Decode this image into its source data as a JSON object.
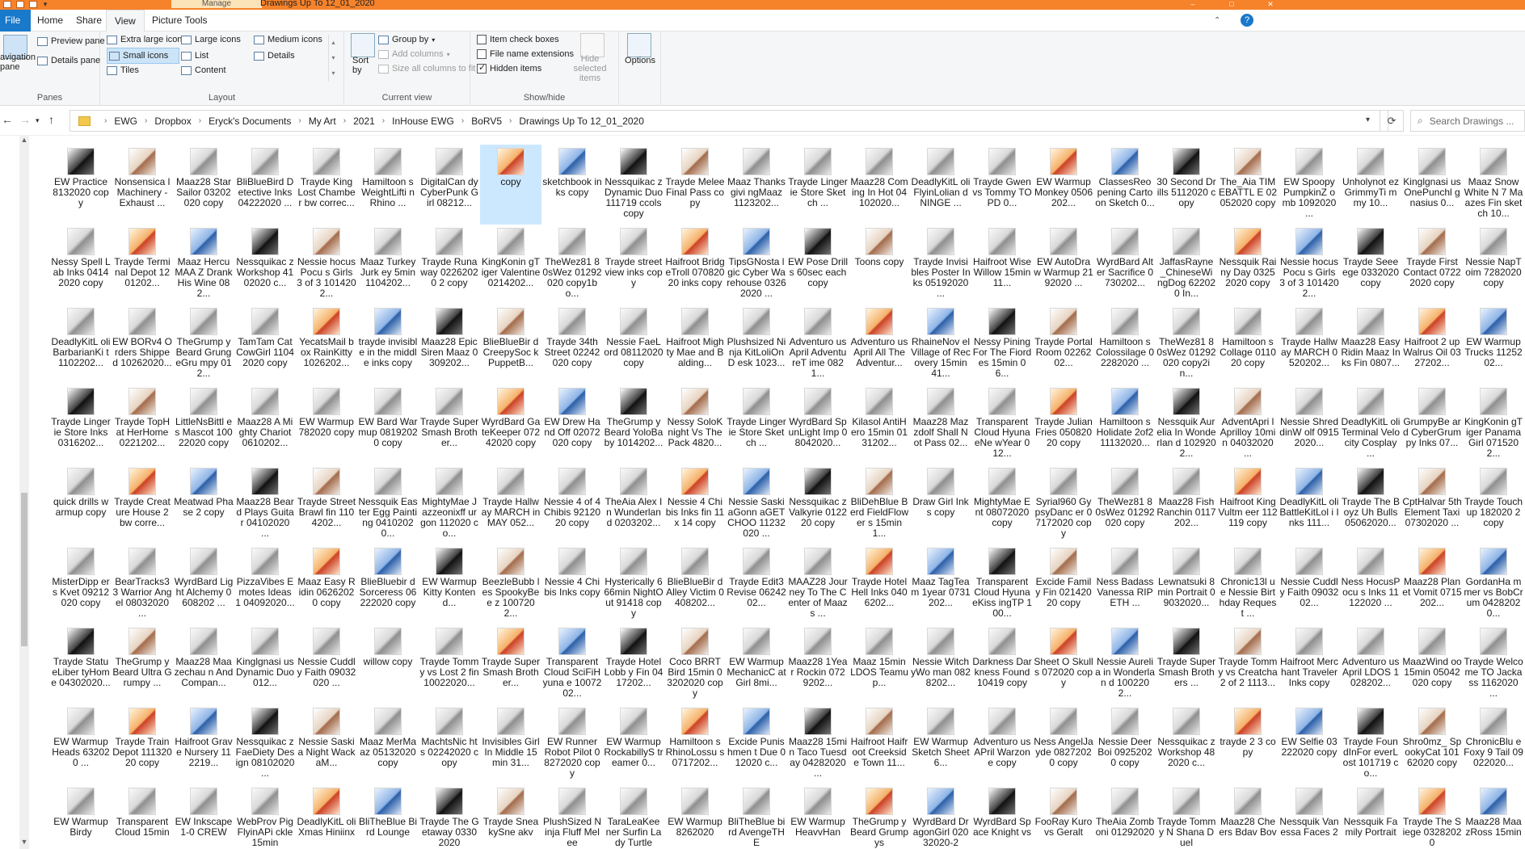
{
  "window": {
    "manage_tab": "Manage",
    "title": "Drawings Up To 12_01_2020"
  },
  "tabs": [
    {
      "label": "File"
    },
    {
      "label": "Home"
    },
    {
      "label": "Share"
    },
    {
      "label": "View"
    },
    {
      "label": "Picture Tools"
    }
  ],
  "ribbon": {
    "panes": {
      "nav_label": "avigation pane",
      "preview": "Preview pane",
      "details": "Details pane",
      "group": "Panes"
    },
    "layout": {
      "extra_large": "Extra large icons",
      "large": "Large icons",
      "medium": "Medium icons",
      "small": "Small icons",
      "list": "List",
      "details": "Details",
      "tiles": "Tiles",
      "content": "Content",
      "group": "Layout"
    },
    "current_view": {
      "sort": "Sort by",
      "group_by": "Group by",
      "add_columns": "Add columns",
      "size_all": "Size all columns to fit",
      "group": "Current view"
    },
    "show_hide": {
      "item_checkboxes": "Item check boxes",
      "file_name_ext": "File name extensions",
      "hidden_items": "Hidden items",
      "hide_selected": "Hide selected items",
      "group": "Show/hide"
    },
    "options": {
      "label": "Options"
    }
  },
  "address": {
    "crumbs": [
      "EWG",
      "Dropbox",
      "Eryck's Documents",
      "My Art",
      "2021",
      "InHouse EWG",
      "BoRV5",
      "Drawings Up To 12_01_2020"
    ],
    "search_placeholder": "Search Drawings ..."
  },
  "files": [
    "EW Practice 8132020 copy",
    "Nonsensica l Machinery - Exhaust ...",
    "Maaz28 StarSailor 03202020 copy",
    "BliBlueBird Detective Inks 04222020 ...",
    "Trayde King Lost Chamber bw correc...",
    "Hamiltoon s WeightLifti n Rhino ...",
    "DigitalCan dy CyberPunk Girl 08212...",
    "copy",
    "sketchbook inks copy",
    "Nessquikac z Dynamic Duo 111719 ccols copy",
    "Trayde Melee Final Pass copy",
    "Maaz Thanksgivi ngMaaz 1123202...",
    "Trayde Lingerie Store Sketch ...",
    "Maaz28 Coming In Hot 04102020...",
    "DeadlyKitL oli FlyinLolian dNINGE ...",
    "Trayde Gwen vs Tommy TOPD 0...",
    "EW Warmup Monkey 0506202...",
    "ClassesReo pening Cartoon Sketch 0...",
    "30 Second Drills 5112020 copy",
    "The_Aia TIMEBATTL E 02052020 copy",
    "EW Spoopy PumpkinZ omb 1092020 ...",
    "Unholynot ez GrimmyTi mmy 10...",
    "Kinglgnasi us OnePunchl gnasius 0...",
    "Maaz Snow White N 7 Maazes Fin sketch 10...",
    "Nessy Spell Lab Inks 04142020 copy",
    "Trayde Terminal Depot 1201202...",
    "Maaz HercuMAA Z Drank His Wine 082...",
    "Nessquikac z Workshop 4102020 c...",
    "Nessie hocusPocu s Girls 3 of 3 1014202...",
    "Maaz TurkeyJurk ey 5min 1104202...",
    "Trayde Runaway 02262020 2 copy",
    "KingKonin gTiger Valentine 0214202...",
    "TheWez81 80sWez 01292020 copy1bo...",
    "Trayde streetview inks copy",
    "Haifroot BridgeTroll 07082020 inks copy",
    "TipsGNosta lgic Cyber Warehouse 03262020 ...",
    "EW Pose Drills 60sec each copy",
    "Toons copy",
    "Trayde Invisibles Poster Inks 05192020 ...",
    "Haifroot Wise Willow 15min 11...",
    "EW AutoDraw Warmup 2192020 ...",
    "WyrdBard Alter Sacrifice 0730202...",
    "JaffasRayne _ChineseWi ngDog 622020 In...",
    "Nessquik Rainy Day 03252020 copy",
    "Nessie hocusPocu s Girls 3 of 3 1014202...",
    "Trayde Seeeege 0332020 copy",
    "Trayde First Contact 07222020 copy",
    "Nessie NapToim 7282020 copy",
    "DeadlyKitL oli BarbarianKi t 1102202...",
    "EW BORv4 Orders Shipped 10262020...",
    "TheGrump yBeard GrungeGru mpy 012...",
    "TamTam CatCowGirl 11042020 copy",
    "YecatsMail box RainKitty 1026202...",
    "trayde invisible in the middle inks copy",
    "Maaz28 Epic Siren Maaz 0309202...",
    "BlieBlueBir d CreepySoc kPuppetB...",
    "Trayde 34th Street 02242020 copy",
    "Nessie FaeLord 08112020 copy",
    "Haifroot Mighty Mae and Balding...",
    "Plushsized Ninja KitLoliOnD esk 1023...",
    "Adventuro usApril AdventureT ime 0821...",
    "Adventuro usApril All The Adventur...",
    "RhaineNov el Village of Recovery 15min 41...",
    "Nessy Pining For The Fiordes 15min 06...",
    "Trayde Portal Room 0226202...",
    "Hamiltoon s Colossilage 02282020 ...",
    "TheWez81 80sWez 01292020 copy2in...",
    "Hamiltoon s Collage 011020 copy",
    "Trayde Hallway MARCH 0520202...",
    "Maaz28 Easy Ridin Maaz Inks Fin 0807...",
    "Haifroot 2 up Walrus Oil 0327202...",
    "EW Warmup Trucks 1125202...",
    "Trayde Lingerie Store Inks 0316202...",
    "Trayde TopHat HerHome 0221202...",
    "LittleNsBittl es Mascot 10022020 copy",
    "Maaz28 A Mighty Chariot 0610202...",
    "EW Warmup 782020 copy",
    "EW Bard Warmup 08192020 copy",
    "Trayde Super Smash Brother...",
    "WyrdBard GateKeeper 07242020 copy",
    "EW Drew Hand Off 02072020 copy",
    "TheGrump yBeard YoloBaby 1014202...",
    "Nessy SoloKnight Vs The Pack 4820...",
    "Trayde Lingerie Store Sketch ...",
    "WyrdBard SpunLight Imp 08042020...",
    "Kilasol AntiHero 15min 0131202...",
    "Maaz28 Mazzdolf Shall Not Pass 02...",
    "Transparent Cloud HyunaeNe wYear 012...",
    "Trayde Julian Fries 05082020 copy",
    "Hamiltoon s Holidate 2of2 11132020...",
    "Nessquik Aurelia In Wonderlan d 1029202...",
    "AdventApri l Aprilloy 10min 04032020 ...",
    "Nessie ShreddinW olf 09152020...",
    "DeadlyKitL oli Terminal Velocity Cosplay ...",
    "GrumpyBe ard CyberGrum py Inks 07...",
    "KingKonin gTiger Panama Girl 0715202...",
    "quick drills warmup copy",
    "Trayde Creature House 2 bw corre...",
    "Meatwad Phase 2 copy",
    "Maaz28 Beard Plays Guitar 04102020 ...",
    "Trayde Street Brawl fin 1104202...",
    "Nessquik Easter Egg Painting 04102020...",
    "MightyMae Jazzeonixff urgon 112020 co...",
    "Trayde Hallway MARCH in MAY 052...",
    "Nessie 4 of 4 Chibis 9212020 copy",
    "TheAia Alex In Wunderlan d 0203202...",
    "Nessie 4 Chibis Inks fin 11 x 14 copy",
    "Nessie SaskiaGonn aGETCHOO 11232020 ...",
    "Nessquikac z Valkyrie 012220 copy",
    "BliDehBlue Berd FieldFlower s 15min 1...",
    "Draw Girl Inks copy",
    "MightyMae Ent 08072020 copy",
    "Syrial960 GypsyDanc er 07172020 copy",
    "TheWez81 80sWez 01292020 copy",
    "Maaz28 Fish Ranchin 0117202...",
    "Haifroot KingVultm eer 112119 copy",
    "DeadlyKitL oli BattleKitLol i Inks 111...",
    "Trayde The Boyz Uh Bulls 05062020...",
    "CptHalvar 5thElement Taxi 07302020 ...",
    "Trayde Touchup 182020 2 copy",
    "MisterDipp ers Kvet 09212020 copy",
    "BearTracks3 3 Warrior Angel 08032020 ...",
    "WyrdBard Light Alchemy 0608202 ...",
    "PizzaVibes Emotes Ideas 1 04092020...",
    "Maaz Easy Ridin 06262020 copy",
    "BlieBluebir d Sorceress 06222020 copy",
    "EW Warmup Kitty Kontend...",
    "BeezleBubb les SpookyBee z 1007202...",
    "Nessie 4 Chibis Inks copy",
    "Hysterically 666min NightOut 91418 copy",
    "BlieBlueBir d Alley Victim 0408202...",
    "Trayde Edit3 Revise 0624202...",
    "MAAZ28 Journey To The Center of Maazs ...",
    "Trayde Hotel Hell Inks 0406202...",
    "Maaz TagTeam 1year 0731202...",
    "Transparent Cloud HyunaeKiss ingTP 100...",
    "Excide Family Fin 02142020 copy",
    "Ness Badass Vanessa RIPETH ...",
    "Lewnatsuki 8min Portrait 09032020...",
    "Chronic13l ue Nessie Birthday Request ...",
    "Nessie Cuddly Faith 0903202...",
    "Ness HocusPocu s Inks 11122020 ...",
    "Maaz28 Planet Vomit 0715202...",
    "GordanHa mmer vs BobCrum 04282020...",
    "Trayde StatueLiber tyHome 04302020...",
    "TheGrump yBeard Ultra Grumpy ...",
    "Maaz28 Maazechau n And Compan...",
    "Kinglgnasi us Dynamic Duo 012...",
    "Nessie Cuddly Faith 09032020 ...",
    "willow copy",
    "Trayde Tommy vs Lost 2 fin 10022020...",
    "Trayde Super Smash Brother...",
    "Transparent Cloud SciFiHyuna e 1007202...",
    "Trayde HotelLobb y Fin 0417202...",
    "Coco BRRT Bird 15min 03202020 copy",
    "EW Warmup MechanicC atGirl 8mi...",
    "Maaz28 1Year Rockin 0729202...",
    "Maaz 15min LDOS Teamup...",
    "Nessie WitchyWo man 0828202...",
    "Darkness Darkness Found 10419 copy",
    "Sheet O Skulls 072020 copy",
    "Nessie Aurelia in Wonderlan d 1002202...",
    "Trayde Super Smash Brothers ...",
    "Trayde Tommy vs Creatcha 2 of 2 1113...",
    "Haifroot Merchant Traveler Inks copy",
    "Adventuro usApril LDOS 1028202...",
    "MaazWind oo 15min 05042020 copy",
    "Trayde Welcome TO Jackass 1162020 ...",
    "EW Warmup Heads 632020 ...",
    "Trayde Train Depot 11132020 copy",
    "Haifroot Grave Nursery 112219...",
    "Nessquikac z FaeDiety Design 08102020 ...",
    "Nessie Saskia Night WackaM...",
    "Maaz MerMaaz 05132020 copy",
    "MachtsNic hts 02242020 copy",
    "Invisibles Girl In Middle 15min 31...",
    "EW Runner Robot Pilot 08272020 copy",
    "EW Warmup RockabillyS treamer 0...",
    "Hamiltoon s RhinoLossu s 0717202...",
    "Excide Punishmen t Due 012020 c...",
    "Maaz28 15min Taco Tuesday 04282020 ...",
    "Haifroot Haifroot Creekside Town 11...",
    "EW Warmup Sketch Sheet 6...",
    "Adventuro usAPril Warzone copy",
    "Ness AngelJayde 08272020 copy",
    "Nessie DeerBoi 09252020 copy",
    "Nessquikac z Workshop 482020 c...",
    "trayde 2 3 copy",
    "EW Selfie 03222020 copy",
    "Trayde FoundInFor everLost 101719 co...",
    "Shro0mz_ SpookyCat 10162020 copy",
    "ChronicBlu e Foxy 9 Tail 09022020...",
    "EW Warmup Birdy",
    "Transparent Cloud 15min",
    "EW Inkscape 1-0 CREW",
    "WebProv PigFlyinAPi ckle 15min",
    "DeadlyKitL oli Xmas Hiniinx",
    "BliTheBlue Bird Lounge",
    "Trayde The Getaway 03302020",
    "Trayde SneakySne akv",
    "PlushSized Ninja Fluff Melee",
    "TaraLeaKee ner Surfin Lady Turtle",
    "EW Warmup 8262020",
    "BliTheBlue bird AvengeTHE",
    "EW Warmup HeavvHan",
    "TheGrump yBeard Grumpys",
    "WyrdBard DragonGirl 02032020-2",
    "WyrdBard Space Knight vs",
    "FooRay Kuro vs Geralt",
    "TheAia Zomboni 01292020",
    "Trayde Tommy N Shana Duel",
    "Maaz28 Cheers Bdav Bov",
    "Nessquik Vanessa Faces 2",
    "Nessquik Family Portrait",
    "Trayde The Siege 03282020",
    "Maaz28 MaazRoss 15min"
  ],
  "selected_index": 7
}
